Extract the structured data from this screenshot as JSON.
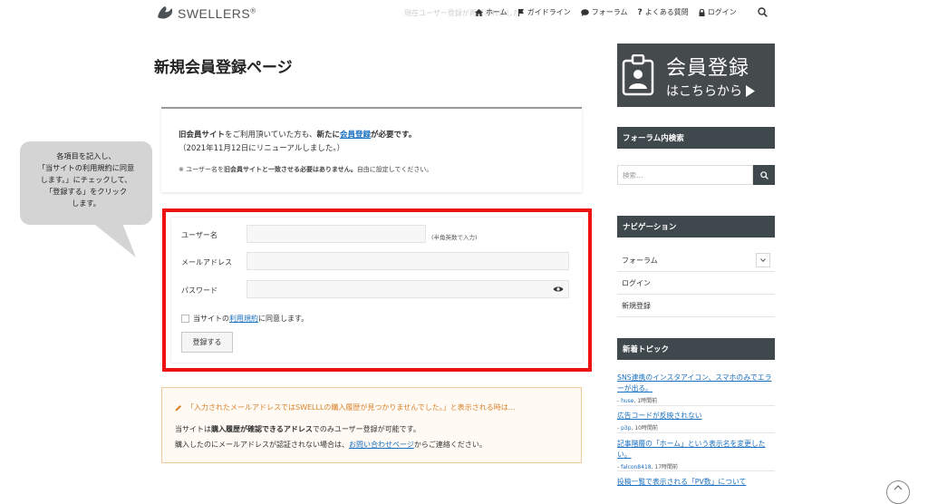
{
  "header": {
    "logo_text": "SWELLERS",
    "logo_mark": "®",
    "ghost_notice": "現在ユーザー登録が再開されました",
    "nav": [
      {
        "label": "ホーム",
        "icon": "home-icon"
      },
      {
        "label": "ガイドライン",
        "icon": "flag-icon"
      },
      {
        "label": "フォーラム",
        "icon": "chat-icon"
      },
      {
        "label": "よくある質問",
        "icon": "question-icon"
      },
      {
        "label": "ログイン",
        "icon": "lock-icon"
      }
    ]
  },
  "main": {
    "title": "新規会員登録ページ",
    "info": {
      "old_site": "旧会員サイト",
      "line1_mid": "をご利用頂いていた方も、",
      "new_label": "新たに",
      "register_link": "会員登録",
      "required": "が必要です。",
      "line2": "（2021年11月12日にリニューアルしました。）",
      "line3_pre": "※ ユーザー名を",
      "line3_bold": "旧会員サイトと一致させる必要はありません。",
      "line3_post": "自由に設定してください。"
    },
    "form": {
      "username_label": "ユーザー名",
      "username_hint": "(半角英数で入力)",
      "username_value": "",
      "email_label": "メールアドレス",
      "email_value": "",
      "password_label": "パスワード",
      "password_value": "",
      "agree_pre": "当サイトの",
      "agree_link": "利用規約",
      "agree_post": "に同意します。",
      "submit_label": "登録する"
    },
    "notice": {
      "title": "「入力されたメールアドレスではSWELLLの購入履歴が見つかりませんでした。」と表示される時は…",
      "line1_pre": "当サイトは",
      "line1_bold": "購入履歴が確認できるアドレス",
      "line1_post": "でのみユーザー登録が可能です。",
      "line2_pre": "購入したのにメールアドレスが認証されない場合は、",
      "line2_link": "お問い合わせページ",
      "line2_post": "からご連絡ください。"
    }
  },
  "callout": {
    "lines": [
      "各項目を記入し、",
      "「当サイトの利用規約に同意",
      "します。」にチェックして、",
      "「登録する」をクリック",
      "します。"
    ]
  },
  "sidebar": {
    "banner_line1": "会員登録",
    "banner_line2": "はこちらから",
    "search_heading": "フォーラム内検索",
    "search_placeholder": "検索…",
    "nav_heading": "ナビゲーション",
    "nav_items": [
      "フォーラム",
      "ログイン",
      "新規登録"
    ],
    "topics_heading": "新着トピック",
    "topics": [
      {
        "title": "SNS連携のインスタアイコン、スマホのみでエラーが出る。",
        "author": "huse",
        "time": "1時間前"
      },
      {
        "title": "広告コードが反映されない",
        "author": "p3p",
        "time": "10時間前"
      },
      {
        "title": "記事階層の「ホーム」という表示名を変更したい。",
        "author": "falcon8418",
        "time": "17時間前"
      },
      {
        "title": "投稿一覧で表示される「PV数」について",
        "author": "",
        "time": ""
      }
    ]
  },
  "colors": {
    "accent_red": "#ee1111",
    "sidebar_dark": "#3f484d",
    "link_blue": "#1a6fc0",
    "notice_orange": "#d9822b"
  }
}
